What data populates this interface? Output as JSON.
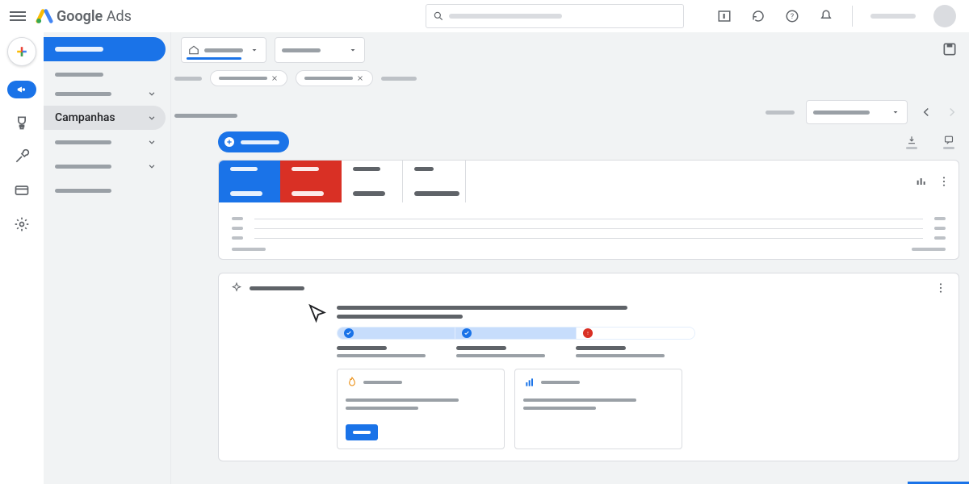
{
  "brand": {
    "name_strong": "Google",
    "name_light": "Ads"
  },
  "search": {
    "placeholder": ""
  },
  "sidebar": {
    "overview": "",
    "recommendations": "",
    "sections": [
      {
        "label": "",
        "expandable": true
      },
      {
        "label": "Campanhas",
        "expandable": true,
        "active": true
      },
      {
        "label": "",
        "expandable": true
      },
      {
        "label": "",
        "expandable": true
      },
      {
        "label": "",
        "expandable": false
      }
    ]
  },
  "pickers": {
    "account": "",
    "all_campaigns": ""
  },
  "filters": {
    "chip1": "",
    "chip2": "",
    "extra": ""
  },
  "page": {
    "title": ""
  },
  "date": {
    "label": "",
    "range": ""
  },
  "actions": {
    "new_campaign": ""
  },
  "scorecards": [
    {
      "metric": "",
      "value": "",
      "color": "blue"
    },
    {
      "metric": "",
      "value": "",
      "color": "red"
    },
    {
      "metric": "",
      "value": "",
      "color": "white"
    },
    {
      "metric": "",
      "value": "",
      "color": "white",
      "long": true
    }
  ],
  "chart_data": {
    "type": "line",
    "series": [
      {
        "name": "",
        "values": []
      }
    ],
    "x": [],
    "ylabel": "",
    "title": ""
  },
  "recommendations": {
    "header": "",
    "headline": "",
    "subhead": "",
    "stages": [
      {
        "name": "",
        "desc": "",
        "status": "done"
      },
      {
        "name": "",
        "desc": "",
        "status": "done"
      },
      {
        "name": "",
        "desc": "",
        "status": "warn"
      }
    ],
    "cards": [
      {
        "icon": "fire",
        "title": "",
        "body": "",
        "body2": "",
        "cta": ""
      },
      {
        "icon": "chart",
        "title": "",
        "body": "",
        "body2": "",
        "cta": ""
      }
    ]
  }
}
